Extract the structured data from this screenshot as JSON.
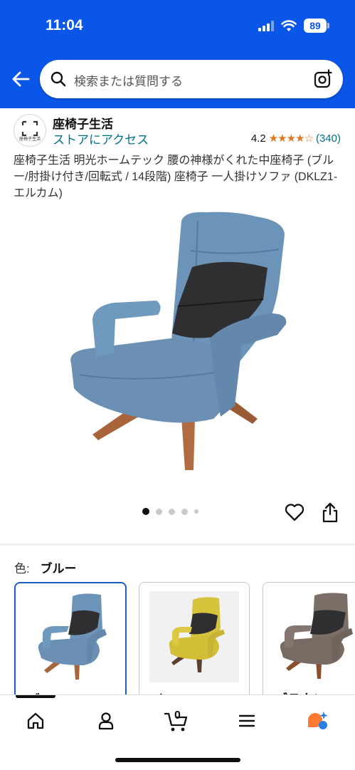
{
  "status_bar": {
    "time": "11:04",
    "battery": "89"
  },
  "search": {
    "placeholder": "検索または質問する"
  },
  "store": {
    "logo_text": "座椅子生活",
    "name": "座椅子生活",
    "link": "ストアにアクセス",
    "rating_value": "4.2",
    "rating_stars": 4.2,
    "rating_count": "(340)"
  },
  "product": {
    "title": "座椅子生活 明光ホームテック 腰の神様がくれた中座椅子 (ブルー/肘掛け付き/回転式 / 14段階) 座椅子 一人掛けソファ (DKLZ1-エルカム)",
    "image_count": 5,
    "active_image": 1
  },
  "color_selector": {
    "label": "色:",
    "selected": "ブルー",
    "options": [
      {
        "label": "ブルー",
        "color": "#5f87a8"
      },
      {
        "label": "イエロー",
        "color": "#d8c33c"
      },
      {
        "label": "ブラウン",
        "color": "#7b6f67"
      }
    ]
  },
  "colors": {
    "brand_blue": "#0a56e8",
    "link": "#007185",
    "star": "#de7921",
    "selected_border": "#1d5ec3"
  },
  "bottom_nav": {
    "items": [
      "home-icon",
      "account-icon",
      "cart-icon",
      "menu-icon",
      "rufus-icon"
    ],
    "cart_count": "0"
  }
}
